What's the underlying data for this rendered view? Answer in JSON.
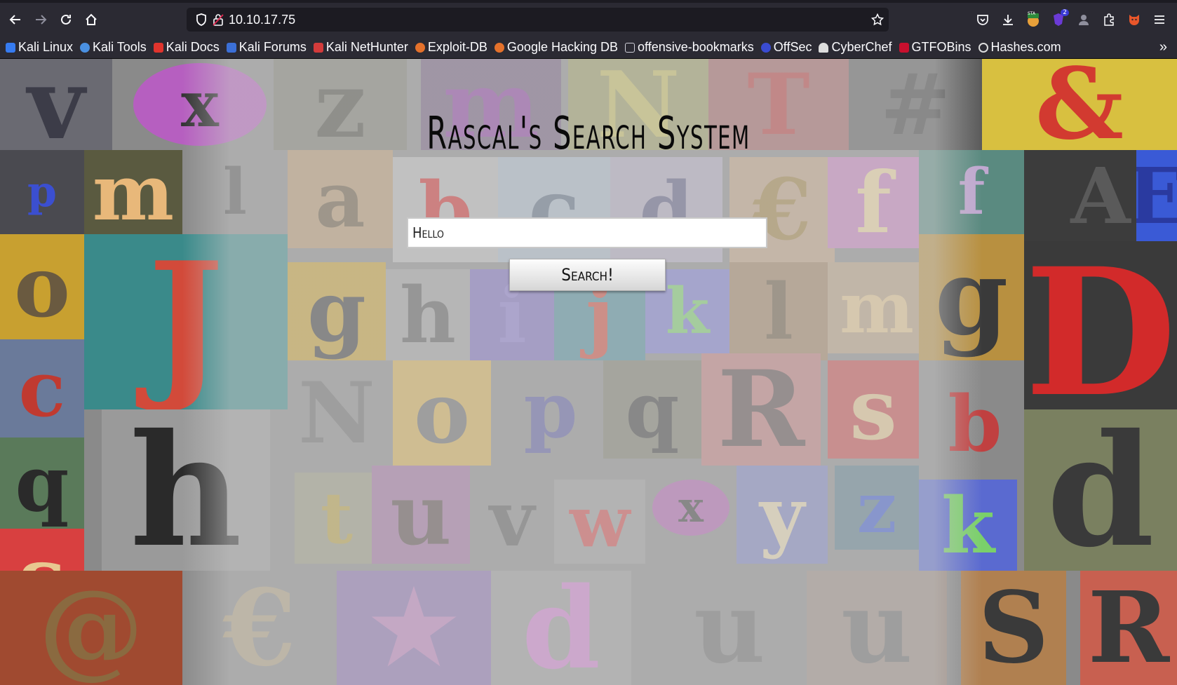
{
  "browser": {
    "url": "10.10.17.75",
    "bookmarks": [
      {
        "label": "Kali Linux",
        "color": "#367bf0"
      },
      {
        "label": "Kali Tools",
        "color": "#4a90e2"
      },
      {
        "label": "Kali Docs",
        "color": "#e0342d"
      },
      {
        "label": "Kali Forums",
        "color": "#3b6fd6"
      },
      {
        "label": "Kali NetHunter",
        "color": "#d33b3b"
      },
      {
        "label": "Exploit-DB",
        "color": "#e4712b"
      },
      {
        "label": "Google Hacking DB",
        "color": "#e4712b"
      },
      {
        "label": "offensive-bookmarks",
        "color": "#cfcfd8"
      },
      {
        "label": "OffSec",
        "color": "#3a4bd1"
      },
      {
        "label": "CyberChef",
        "color": "#dddddd"
      },
      {
        "label": "GTFOBins",
        "color": "#c8102e"
      },
      {
        "label": "Hashes.com",
        "color": "#dddddd"
      }
    ],
    "extension_badges": {
      "sta": "STA",
      "count": "2"
    }
  },
  "page": {
    "title": "Rascal's Search System",
    "search_value": "Hello",
    "search_button": "Search!"
  }
}
